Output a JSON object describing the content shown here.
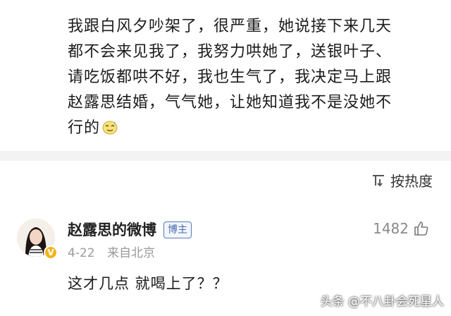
{
  "post": {
    "lines": [
      "我跟白风夕吵架了，很严重，她说接下来几天",
      "都不会来见我了，我努力哄她了，送银叶子、",
      "请吃饭都哄不好，我也生气了，我决定马上跟",
      "赵露思结婚，气气她，让她知道我不是没她不",
      "行的"
    ],
    "emoji": "sweat-smile-emoji"
  },
  "sort": {
    "label": "按热度",
    "icon": "sort-icon"
  },
  "comment": {
    "author": "赵露思的微博",
    "badge": "博主",
    "date": "4-22",
    "location": "来自北京",
    "likes": "1482",
    "text": "这才几点 就喝上了？？"
  },
  "watermark": "头条 @不八卦会死星人"
}
